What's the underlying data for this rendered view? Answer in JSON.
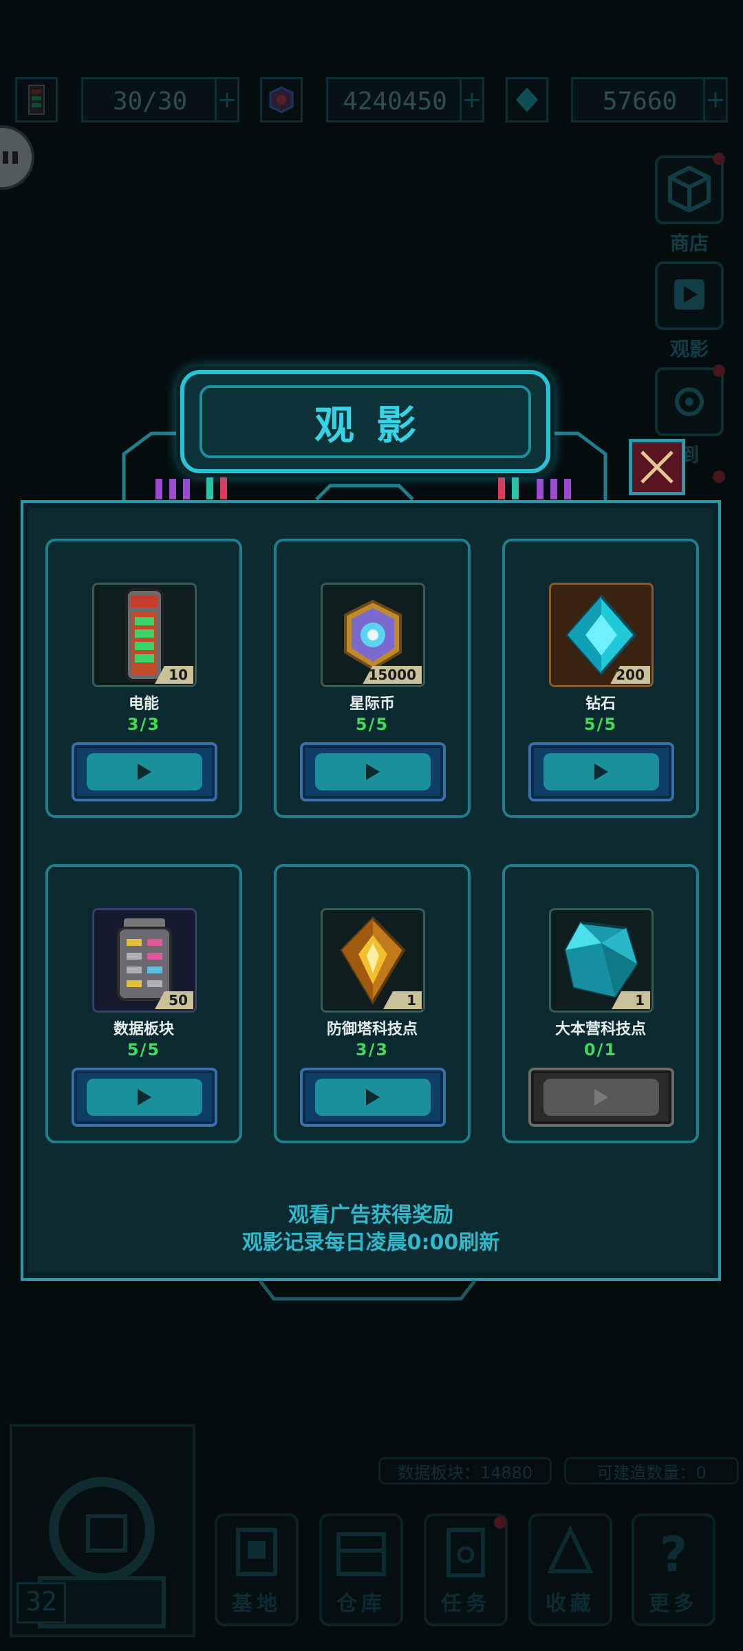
{
  "resources": {
    "energy_value": "30/30",
    "coin_value": "4240450",
    "diamond_value": "57660"
  },
  "side_menu": {
    "shop_label": "商店",
    "watch_label": "观影",
    "signin_label": "到"
  },
  "dialog": {
    "title": "观影",
    "footer_line1": "观看广告获得奖励",
    "footer_line2": "观影记录每日凌晨0:00刷新",
    "items": [
      {
        "name": "电能",
        "qty": "10",
        "count": "3/3",
        "icon": "energy-battery-icon",
        "enabled": true
      },
      {
        "name": "星际币",
        "qty": "15000",
        "count": "5/5",
        "icon": "star-coin-icon",
        "enabled": true
      },
      {
        "name": "钻石",
        "qty": "200",
        "count": "5/5",
        "icon": "diamond-icon",
        "enabled": true
      },
      {
        "name": "数据板块",
        "qty": "50",
        "count": "5/5",
        "icon": "data-board-icon",
        "enabled": true
      },
      {
        "name": "防御塔科技点",
        "qty": "1",
        "count": "3/3",
        "icon": "tower-tech-point-icon",
        "enabled": true
      },
      {
        "name": "大本营科技点",
        "qty": "1",
        "count": "0/1",
        "icon": "base-tech-point-icon",
        "enabled": false
      }
    ]
  },
  "bottom": {
    "data_board_info": "数据板块：14880",
    "buildable_info": "可建造数量：0",
    "level": "32",
    "nav": [
      "基地",
      "仓库",
      "任务",
      "收藏",
      "更多"
    ]
  },
  "colors": {
    "accent": "#28c3d6",
    "count_green": "#3ddc5a",
    "close_bg": "#5a1523",
    "notification_red": "#c42b3a"
  }
}
